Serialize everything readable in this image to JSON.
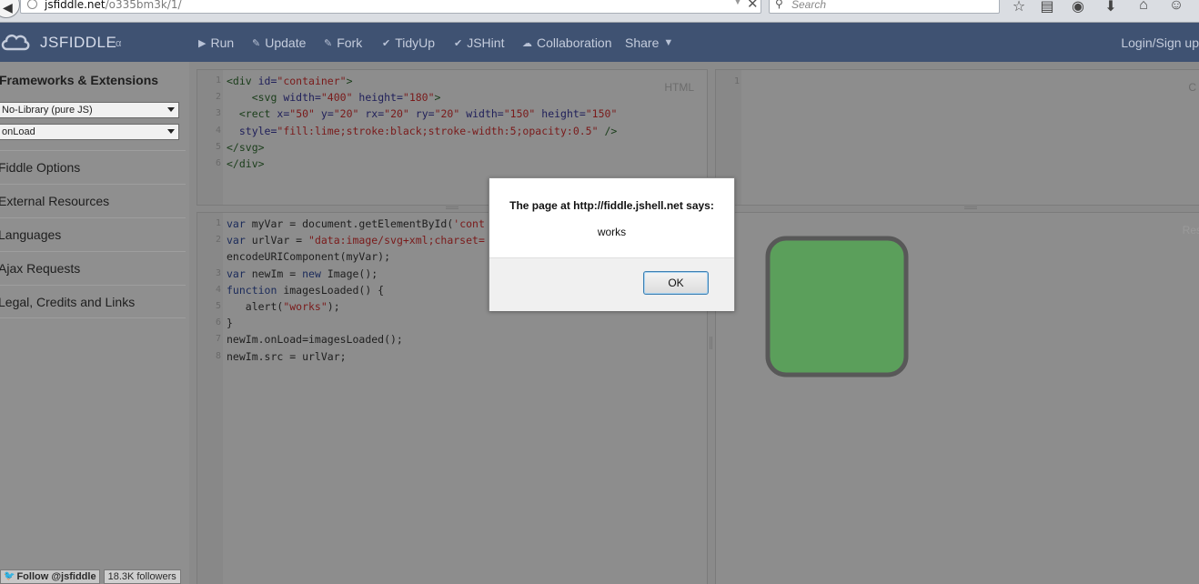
{
  "browser": {
    "url_host": "jsfiddle.net",
    "url_path": "/o335bm3k/1/",
    "search_placeholder": "Search"
  },
  "header": {
    "logo": "JSFIDDLE",
    "logo_suffix": "α",
    "nav": [
      {
        "label": "Run",
        "icon": "play-icon"
      },
      {
        "label": "Update",
        "icon": "pencil-icon"
      },
      {
        "label": "Fork",
        "icon": "fork-icon"
      },
      {
        "label": "TidyUp",
        "icon": "check-icon"
      },
      {
        "label": "JSHint",
        "icon": "check-icon"
      },
      {
        "label": "Collaboration",
        "icon": "people-icon"
      },
      {
        "label": "Share",
        "icon": "caret-down-icon"
      }
    ],
    "login": "Login/Sign up"
  },
  "sidebar": {
    "title": "Frameworks & Extensions",
    "library_select": "No-Library (pure JS)",
    "load_select": "onLoad",
    "links": [
      "Fiddle Options",
      "External Resources",
      "Languages",
      "Ajax Requests",
      "Legal, Credits and Links"
    ],
    "follow": "Follow @jsfiddle",
    "followers": "18.3K followers"
  },
  "html_panel": {
    "label": "HTML",
    "lines": [
      {
        "n": "1",
        "parts": [
          [
            "tag",
            "<div "
          ],
          [
            "attr",
            "id="
          ],
          [
            "str",
            "\"container\""
          ],
          [
            "tag",
            ">"
          ]
        ]
      },
      {
        "n": "2",
        "parts": [
          [
            "plain",
            "    "
          ],
          [
            "tag",
            "<svg "
          ],
          [
            "attr",
            "width="
          ],
          [
            "str",
            "\"400\" "
          ],
          [
            "attr",
            "height="
          ],
          [
            "str",
            "\"180\""
          ],
          [
            "tag",
            ">"
          ]
        ]
      },
      {
        "n": "3",
        "parts": [
          [
            "plain",
            "  "
          ],
          [
            "tag",
            "<rect "
          ],
          [
            "attr",
            "x="
          ],
          [
            "str",
            "\"50\" "
          ],
          [
            "attr",
            "y="
          ],
          [
            "str",
            "\"20\" "
          ],
          [
            "attr",
            "rx="
          ],
          [
            "str",
            "\"20\" "
          ],
          [
            "attr",
            "ry="
          ],
          [
            "str",
            "\"20\" "
          ],
          [
            "attr",
            "width="
          ],
          [
            "str",
            "\"150\" "
          ],
          [
            "attr",
            "height="
          ],
          [
            "str",
            "\"150\""
          ]
        ]
      },
      {
        "n": "4",
        "parts": [
          [
            "plain",
            "  "
          ],
          [
            "attr",
            "style="
          ],
          [
            "str",
            "\"fill:lime;stroke:black;stroke-width:5;opacity:0.5\" "
          ],
          [
            "tag",
            "/>"
          ]
        ]
      },
      {
        "n": "5",
        "parts": [
          [
            "tag",
            "</svg>"
          ]
        ]
      },
      {
        "n": "6",
        "parts": [
          [
            "tag",
            "</div>"
          ]
        ]
      }
    ]
  },
  "css_panel": {
    "label": "C",
    "line_number": "1"
  },
  "js_panel": {
    "lines": [
      {
        "n": "1",
        "parts": [
          [
            "kw",
            "var "
          ],
          [
            "plain",
            "myVar = document.getElementById("
          ],
          [
            "str",
            "'cont"
          ]
        ]
      },
      {
        "n": "2",
        "parts": [
          [
            "kw",
            "var "
          ],
          [
            "plain",
            "urlVar = "
          ],
          [
            "str",
            "\"data:image/svg+xml;charset="
          ]
        ]
      },
      {
        "n": "",
        "parts": [
          [
            "plain",
            "encodeURIComponent(myVar);"
          ]
        ]
      },
      {
        "n": "3",
        "parts": [
          [
            "kw",
            "var "
          ],
          [
            "plain",
            "newIm = "
          ],
          [
            "kw",
            "new "
          ],
          [
            "plain",
            "Image();"
          ]
        ]
      },
      {
        "n": "4",
        "parts": [
          [
            "kw",
            "function "
          ],
          [
            "plain",
            "imagesLoaded() {"
          ]
        ]
      },
      {
        "n": "5",
        "parts": [
          [
            "plain",
            "   alert("
          ],
          [
            "str",
            "\"works\""
          ],
          [
            "plain",
            ");"
          ]
        ]
      },
      {
        "n": "6",
        "parts": [
          [
            "plain",
            "}"
          ]
        ]
      },
      {
        "n": "7",
        "parts": [
          [
            "plain",
            "newIm.onLoad=imagesLoaded();"
          ]
        ]
      },
      {
        "n": "8",
        "parts": [
          [
            "plain",
            "newIm.src = urlVar;"
          ]
        ]
      }
    ]
  },
  "result_panel": {
    "label": "Res",
    "rect_fill": "#5b9f5b",
    "rect_stroke": "#585858"
  },
  "dialog": {
    "title": "The page at http://fiddle.jshell.net says:",
    "message": "works",
    "ok": "OK"
  }
}
